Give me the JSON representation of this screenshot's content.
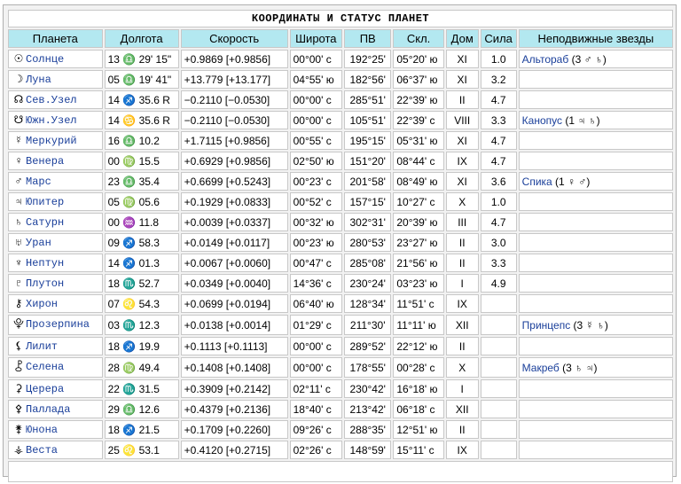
{
  "title": "КООРДИНАТЫ И СТАТУС ПЛАНЕТ",
  "headers": [
    "Планета",
    "Долгота",
    "Скорость",
    "Широта",
    "ПВ",
    "Скл.",
    "Дом",
    "Сила",
    "Неподвижные звезды"
  ],
  "rows": [
    {
      "glyph": "☉",
      "name": "Солнце",
      "lon": "13 ♎ 29' 15\"",
      "speed": "+0.9869  [+0.9856]",
      "lat": "00°00' с",
      "pv": "192°25'",
      "decl": "05°20' ю",
      "house": "XI",
      "power": "1.0",
      "star": "Альтораб",
      "star_extra": " (3 ♂ ♄)"
    },
    {
      "glyph": "☽",
      "name": "Луна",
      "lon": "05 ♎ 19' 41\"",
      "speed": "+13.779  [+13.177]",
      "lat": "04°55' ю",
      "pv": "182°56'",
      "decl": "06°37' ю",
      "house": "XI",
      "power": "3.2",
      "star": "",
      "star_extra": ""
    },
    {
      "glyph": "☊",
      "name": "Сев.Узел",
      "lon": "14 ♐ 35.6  R",
      "speed": "−0.2110  [−0.0530]",
      "lat": "00°00' с",
      "pv": "285°51'",
      "decl": "22°39' ю",
      "house": "II",
      "power": "4.7",
      "star": "",
      "star_extra": ""
    },
    {
      "glyph": "☋",
      "name": "Южн.Узел",
      "lon": "14 ♋ 35.6  R",
      "speed": "−0.2110  [−0.0530]",
      "lat": "00°00' с",
      "pv": "105°51'",
      "decl": "22°39' с",
      "house": "VIII",
      "power": "3.3",
      "star": "Канопус",
      "star_extra": " (1 ♃ ♄)"
    },
    {
      "glyph": "☿",
      "name": "Меркурий",
      "lon": "16 ♎ 10.2",
      "speed": "+1.7115  [+0.9856]",
      "lat": "00°55' с",
      "pv": "195°15'",
      "decl": "05°31' ю",
      "house": "XI",
      "power": "4.7",
      "star": "",
      "star_extra": ""
    },
    {
      "glyph": "♀",
      "name": "Венера",
      "lon": "00 ♍ 15.5",
      "speed": "+0.6929  [+0.9856]",
      "lat": "02°50' ю",
      "pv": "151°20'",
      "decl": "08°44' с",
      "house": "IX",
      "power": "4.7",
      "star": "",
      "star_extra": ""
    },
    {
      "glyph": "♂",
      "name": "Марс",
      "lon": "23 ♎ 35.4",
      "speed": "+0.6699  [+0.5243]",
      "lat": "00°23' с",
      "pv": "201°58'",
      "decl": "08°49' ю",
      "house": "XI",
      "power": "3.6",
      "star": "Спика",
      "star_extra": " (1 ♀ ♂)"
    },
    {
      "glyph": "♃",
      "name": "Юпитер",
      "lon": "05 ♍ 05.6",
      "speed": "+0.1929  [+0.0833]",
      "lat": "00°52' с",
      "pv": "157°15'",
      "decl": "10°27' с",
      "house": "X",
      "power": "1.0",
      "star": "",
      "star_extra": ""
    },
    {
      "glyph": "♄",
      "name": "Сатурн",
      "lon": "00 ♒ 11.8",
      "speed": "+0.0039  [+0.0337]",
      "lat": "00°32' ю",
      "pv": "302°31'",
      "decl": "20°39' ю",
      "house": "III",
      "power": "4.7",
      "star": "",
      "star_extra": ""
    },
    {
      "glyph": "♅",
      "name": "Уран",
      "lon": "09 ♐ 58.3",
      "speed": "+0.0149  [+0.0117]",
      "lat": "00°23' ю",
      "pv": "280°53'",
      "decl": "23°27' ю",
      "house": "II",
      "power": "3.0",
      "star": "",
      "star_extra": ""
    },
    {
      "glyph": "♆",
      "name": "Нептун",
      "lon": "14 ♐ 01.3",
      "speed": "+0.0067  [+0.0060]",
      "lat": "00°47' с",
      "pv": "285°08'",
      "decl": "21°56' ю",
      "house": "II",
      "power": "3.3",
      "star": "",
      "star_extra": ""
    },
    {
      "glyph": "♇",
      "name": "Плутон",
      "lon": "18 ♏ 52.7",
      "speed": "+0.0349  [+0.0040]",
      "lat": "14°36' с",
      "pv": "230°24'",
      "decl": "03°23' ю",
      "house": "I",
      "power": "4.9",
      "star": "",
      "star_extra": ""
    },
    {
      "glyph": "⚷",
      "name": "Хирон",
      "lon": "07 ♌ 54.3",
      "speed": "+0.0699  [+0.0194]",
      "lat": "06°40' ю",
      "pv": "128°34'",
      "decl": "11°51' с",
      "house": "IX",
      "power": "",
      "star": "",
      "star_extra": ""
    },
    {
      "glyph": "⯓",
      "name": "Прозерпина",
      "lon": "03 ♏ 12.3",
      "speed": "+0.0138  [+0.0014]",
      "lat": "01°29' с",
      "pv": "211°30'",
      "decl": "11°11' ю",
      "house": "XII",
      "power": "",
      "star": "Принцепс",
      "star_extra": " (3 ☿ ♄)"
    },
    {
      "glyph": "⚸",
      "name": "Лилит",
      "lon": "18 ♐ 19.9",
      "speed": "+0.1113  [+0.1113]",
      "lat": "00°00' с",
      "pv": "289°52'",
      "decl": "22°12' ю",
      "house": "II",
      "power": "",
      "star": "",
      "star_extra": ""
    },
    {
      "glyph": "⯛",
      "name": "Селена",
      "lon": "28 ♍ 49.4",
      "speed": "+0.1408  [+0.1408]",
      "lat": "00°00' с",
      "pv": "178°55'",
      "decl": "00°28' с",
      "house": "X",
      "power": "",
      "star": "Макреб",
      "star_extra": " (3 ♄ ♃)"
    },
    {
      "glyph": "⚳",
      "name": "Церера",
      "lon": "22 ♏ 31.5",
      "speed": "+0.3909  [+0.2142]",
      "lat": "02°11' с",
      "pv": "230°42'",
      "decl": "16°18' ю",
      "house": "I",
      "power": "",
      "star": "",
      "star_extra": ""
    },
    {
      "glyph": "⚴",
      "name": "Паллада",
      "lon": "29 ♎ 12.6",
      "speed": "+0.4379  [+0.2136]",
      "lat": "18°40' с",
      "pv": "213°42'",
      "decl": "06°18' с",
      "house": "XII",
      "power": "",
      "star": "",
      "star_extra": ""
    },
    {
      "glyph": "⚵",
      "name": "Юнона",
      "lon": "18 ♐ 21.5",
      "speed": "+0.1709  [+0.2260]",
      "lat": "09°26' с",
      "pv": "288°35'",
      "decl": "12°51' ю",
      "house": "II",
      "power": "",
      "star": "",
      "star_extra": ""
    },
    {
      "glyph": "⚶",
      "name": "Веста",
      "lon": "25 ♌ 53.1",
      "speed": "+0.4120  [+0.2715]",
      "lat": "02°26' с",
      "pv": "148°59'",
      "decl": "15°11' с",
      "house": "IX",
      "power": "",
      "star": "",
      "star_extra": ""
    }
  ]
}
